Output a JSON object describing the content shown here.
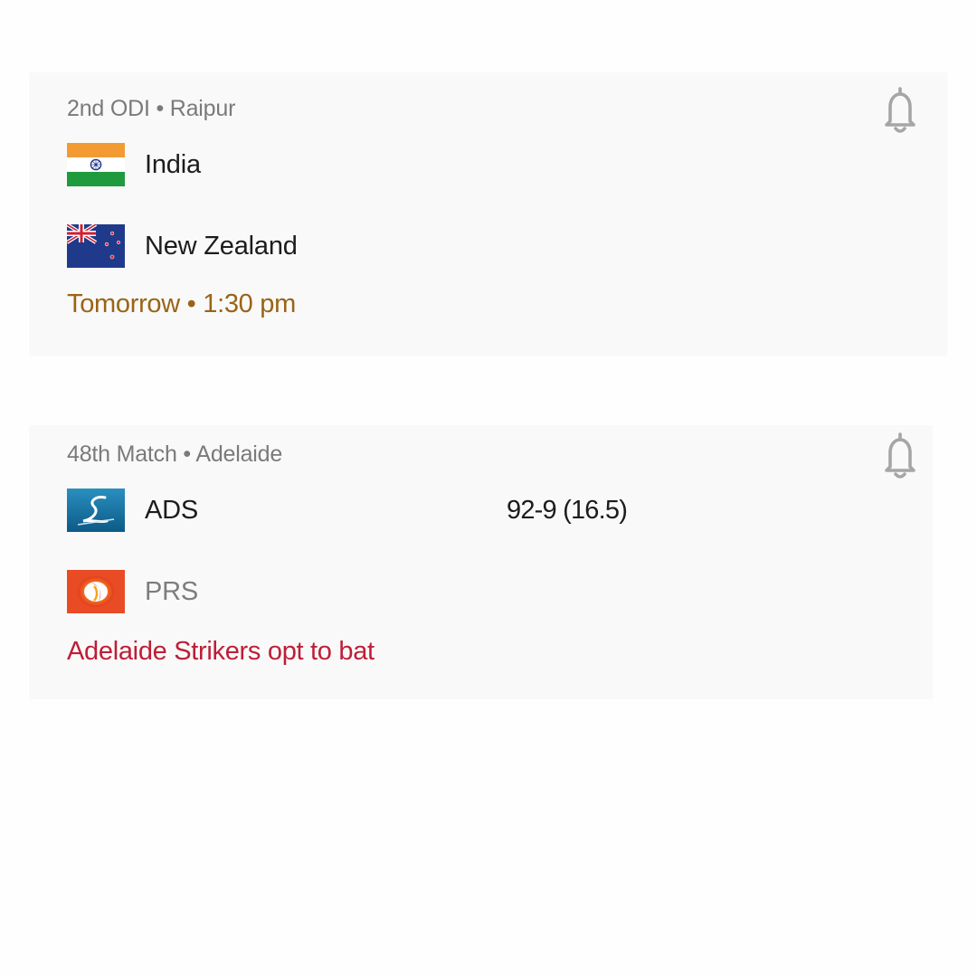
{
  "matches": [
    {
      "meta": "2nd ODI • Raipur",
      "teams": [
        {
          "name": "India",
          "flag": "india-flag-icon",
          "score": ""
        },
        {
          "name": "New Zealand",
          "flag": "new-zealand-flag-icon",
          "score": ""
        }
      ],
      "status": "Tomorrow • 1:30 pm",
      "status_color": "#9a6416"
    },
    {
      "meta": "48th Match • Adelaide",
      "teams": [
        {
          "name": "ADS",
          "flag": "adelaide-strikers-logo-icon",
          "score": "92-9 (16.5)"
        },
        {
          "name": "PRS",
          "flag": "perth-scorchers-logo-icon",
          "score": ""
        }
      ],
      "status": "Adelaide Strikers opt to bat",
      "status_color": "#be1e37"
    }
  ],
  "colors": {
    "card_background": "#f9f9f9",
    "meta_text": "#7a7a7a",
    "bell_icon": "#a6a6a6"
  }
}
